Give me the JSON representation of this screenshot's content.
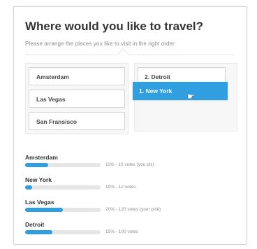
{
  "poll": {
    "title": "Where would you like to travel?",
    "subtitle": "Please arrange the places you like to visit in the right order"
  },
  "available": [
    {
      "label": "Amsterdam"
    },
    {
      "label": "Las Vegas"
    },
    {
      "label": "San Fransisco"
    }
  ],
  "ranked": [
    {
      "label": "2. Detroit"
    }
  ],
  "dragging": {
    "label": "1. New York"
  },
  "results": [
    {
      "label": "Amsterdam",
      "percent": 31,
      "detail": "11% - 10 votes (you plz)"
    },
    {
      "label": "New York",
      "percent": 9,
      "detail": "10% - 12 votes"
    },
    {
      "label": "Las Vegas",
      "percent": 50,
      "detail": "20% - 120 votes (your pick)"
    },
    {
      "label": "Detroit",
      "percent": 36,
      "detail": "15% - 100 votes"
    }
  ],
  "colors": {
    "accent": "#2f9fe0"
  }
}
